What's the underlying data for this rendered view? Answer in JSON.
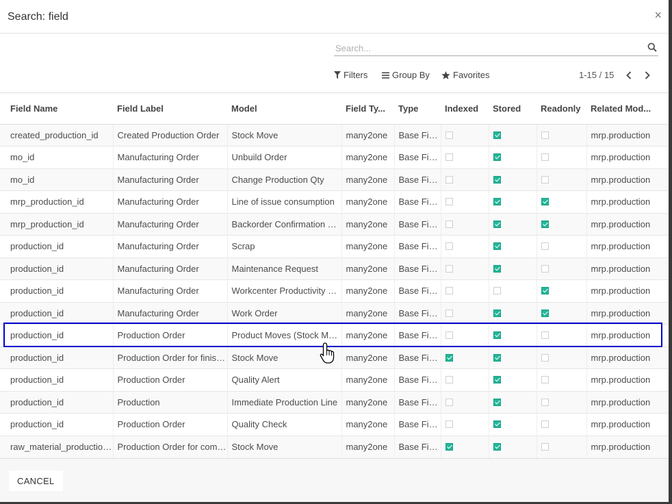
{
  "dialog": {
    "title": "Search: field",
    "close_glyph": "×"
  },
  "search": {
    "placeholder": "Search...",
    "value": ""
  },
  "controls": {
    "filters": "Filters",
    "group_by": "Group By",
    "favorites": "Favorites"
  },
  "pager": {
    "value": "1-15 / 15"
  },
  "table": {
    "headers": [
      "Field Name",
      "Field Label",
      "Model",
      "Field Ty...",
      "Type",
      "Indexed",
      "Stored",
      "Readonly",
      "Related Mod..."
    ],
    "rows": [
      {
        "field_name": "created_production_id",
        "field_label": "Created Production Order",
        "model": "Stock Move",
        "field_type": "many2one",
        "type": "Base Field",
        "indexed": false,
        "stored": true,
        "readonly": false,
        "related_model": "mrp.production"
      },
      {
        "field_name": "mo_id",
        "field_label": "Manufacturing Order",
        "model": "Unbuild Order",
        "field_type": "many2one",
        "type": "Base Field",
        "indexed": false,
        "stored": true,
        "readonly": false,
        "related_model": "mrp.production"
      },
      {
        "field_name": "mo_id",
        "field_label": "Manufacturing Order",
        "model": "Change Production Qty",
        "field_type": "many2one",
        "type": "Base Field",
        "indexed": false,
        "stored": true,
        "readonly": false,
        "related_model": "mrp.production"
      },
      {
        "field_name": "mrp_production_id",
        "field_label": "Manufacturing Order",
        "model": "Line of issue consumption",
        "field_type": "many2one",
        "type": "Base Field",
        "indexed": false,
        "stored": true,
        "readonly": true,
        "related_model": "mrp.production"
      },
      {
        "field_name": "mrp_production_id",
        "field_label": "Manufacturing Order",
        "model": "Backorder Confirmation Line",
        "field_type": "many2one",
        "type": "Base Field",
        "indexed": false,
        "stored": true,
        "readonly": true,
        "related_model": "mrp.production"
      },
      {
        "field_name": "production_id",
        "field_label": "Manufacturing Order",
        "model": "Scrap",
        "field_type": "many2one",
        "type": "Base Field",
        "indexed": false,
        "stored": true,
        "readonly": false,
        "related_model": "mrp.production"
      },
      {
        "field_name": "production_id",
        "field_label": "Manufacturing Order",
        "model": "Maintenance Request",
        "field_type": "many2one",
        "type": "Base Field",
        "indexed": false,
        "stored": true,
        "readonly": false,
        "related_model": "mrp.production"
      },
      {
        "field_name": "production_id",
        "field_label": "Manufacturing Order",
        "model": "Workcenter Productivity Log",
        "field_type": "many2one",
        "type": "Base Field",
        "indexed": false,
        "stored": false,
        "readonly": true,
        "related_model": "mrp.production"
      },
      {
        "field_name": "production_id",
        "field_label": "Manufacturing Order",
        "model": "Work Order",
        "field_type": "many2one",
        "type": "Base Field",
        "indexed": false,
        "stored": true,
        "readonly": true,
        "related_model": "mrp.production"
      },
      {
        "field_name": "production_id",
        "field_label": "Production Order",
        "model": "Product Moves (Stock Move Line)",
        "field_type": "many2one",
        "type": "Base Field",
        "indexed": false,
        "stored": true,
        "readonly": false,
        "related_model": "mrp.production"
      },
      {
        "field_name": "production_id",
        "field_label": "Production Order for finished products",
        "model": "Stock Move",
        "field_type": "many2one",
        "type": "Base Field",
        "indexed": true,
        "stored": true,
        "readonly": false,
        "related_model": "mrp.production"
      },
      {
        "field_name": "production_id",
        "field_label": "Production Order",
        "model": "Quality Alert",
        "field_type": "many2one",
        "type": "Base Field",
        "indexed": false,
        "stored": true,
        "readonly": false,
        "related_model": "mrp.production"
      },
      {
        "field_name": "production_id",
        "field_label": "Production",
        "model": "Immediate Production Line",
        "field_type": "many2one",
        "type": "Base Field",
        "indexed": false,
        "stored": true,
        "readonly": false,
        "related_model": "mrp.production"
      },
      {
        "field_name": "production_id",
        "field_label": "Production Order",
        "model": "Quality Check",
        "field_type": "many2one",
        "type": "Base Field",
        "indexed": false,
        "stored": true,
        "readonly": false,
        "related_model": "mrp.production"
      },
      {
        "field_name": "raw_material_production_id",
        "field_label": "Production Order for components",
        "model": "Stock Move",
        "field_type": "many2one",
        "type": "Base Field",
        "indexed": true,
        "stored": true,
        "readonly": false,
        "related_model": "mrp.production"
      }
    ]
  },
  "footer": {
    "cancel_label": "CANCEL"
  },
  "colors": {
    "checkbox_checked": "#21b799",
    "highlight_border": "#0000cc"
  }
}
